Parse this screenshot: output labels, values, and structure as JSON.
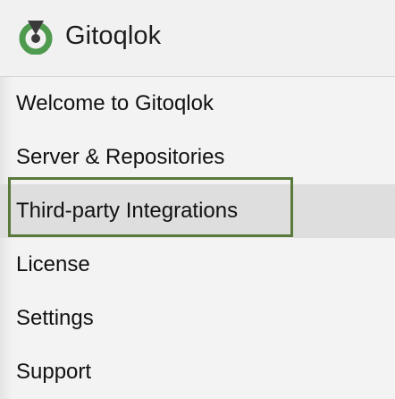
{
  "app": {
    "title": "Gitoqlok",
    "logo_icon": "gitoqlok-logo-icon",
    "colors": {
      "logo_green": "#4e9a4f",
      "logo_dark": "#3a3a3a",
      "focus_border": "#5a7a3c",
      "selected_bg": "#dedede"
    }
  },
  "sidebar": {
    "items": [
      {
        "label": "Welcome to Gitoqlok",
        "selected": false
      },
      {
        "label": "Server & Repositories",
        "selected": false
      },
      {
        "label": "Third-party Integrations",
        "selected": true
      },
      {
        "label": "License",
        "selected": false
      },
      {
        "label": "Settings",
        "selected": false
      },
      {
        "label": "Support",
        "selected": false
      }
    ]
  }
}
